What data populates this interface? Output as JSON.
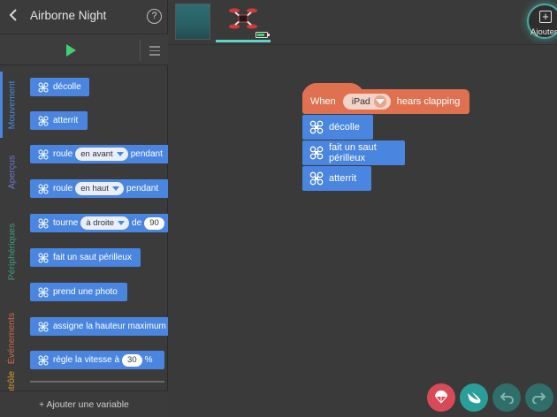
{
  "header": {
    "back_icon": "chevron-left-icon",
    "title": "Airborne Night",
    "help_label": "?"
  },
  "categories": [
    {
      "label": "Mouvement",
      "color": "#4a86e0",
      "active": true
    },
    {
      "label": "Aperçus",
      "color": "#6b77c9",
      "active": false
    },
    {
      "label": "Périphériques",
      "color": "#3f9d7d",
      "active": false
    },
    {
      "label": "Événements",
      "color": "#d0694a",
      "active": false
    },
    {
      "label": "ntrôle",
      "color": "#d89a2d",
      "active": false
    }
  ],
  "palette": {
    "decolle": "décolle",
    "atterrit": "atterrit",
    "roule1": {
      "text": "roule",
      "option": "en avant",
      "suffix": "pendant"
    },
    "roule2": {
      "text": "roule",
      "option": "en haut",
      "suffix": "pendant"
    },
    "tourne": {
      "text": "tourne",
      "option": "à droite",
      "mid": "de",
      "value": "90"
    },
    "saut": "fait un saut périlleux",
    "photo": "prend une photo",
    "hauteur": "assigne la hauteur maximum à",
    "vitesse": {
      "text": "règle la vitesse à",
      "value": "30",
      "unit": "%"
    }
  },
  "add_variable": "+ Ajouter une variable",
  "add_button": "Ajouter",
  "script": {
    "hat": {
      "when": "When",
      "device": "iPad",
      "event": "hears clapping"
    },
    "blocks": [
      "décolle",
      "fait un saut périlleux",
      "atterrit"
    ]
  },
  "colors": {
    "motion": "#4a86e0",
    "event": "#e07150",
    "play": "#3dd26d",
    "accent": "#5fd3c6"
  },
  "bottom_buttons": [
    "parachute-icon",
    "swift-icon",
    "undo-icon",
    "redo-icon"
  ]
}
